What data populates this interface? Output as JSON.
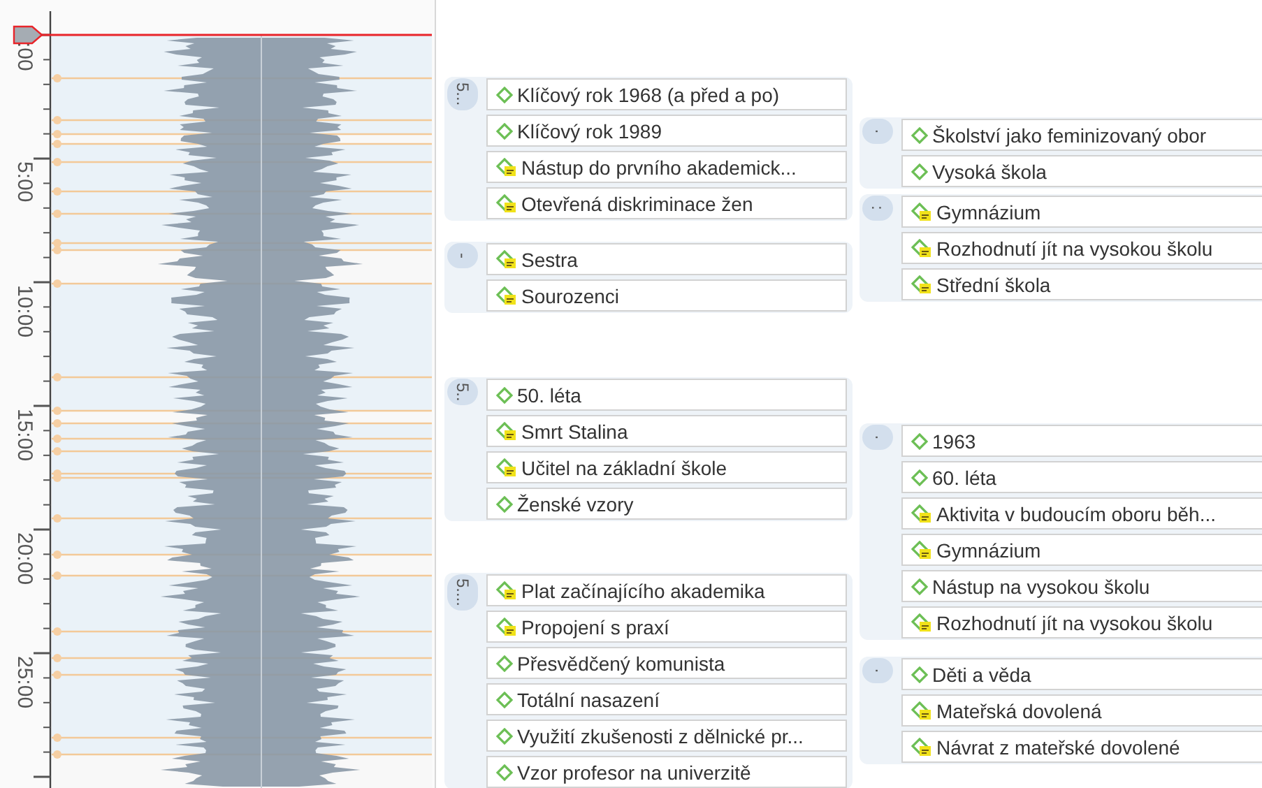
{
  "timeline": {
    "time_labels": [
      ":00",
      "5:00",
      "10:00",
      "15:00",
      "20:00",
      "25:00"
    ]
  },
  "columns": [
    {
      "groups": [
        {
          "badge": "5...",
          "items": [
            {
              "label": "Klíčový rok 1968 (a před a po)",
              "kind": "code"
            },
            {
              "label": "Klíčový rok 1989",
              "kind": "code"
            },
            {
              "label": "Nástup do prvního akademick...",
              "kind": "memo"
            },
            {
              "label": "Otevřená diskriminace žen",
              "kind": "memo"
            }
          ]
        },
        {
          "badge": "-",
          "items": [
            {
              "label": "Sestra",
              "kind": "memo"
            },
            {
              "label": "Sourozenci",
              "kind": "memo"
            }
          ]
        },
        {
          "badge": "5..",
          "items": [
            {
              "label": "50. léta",
              "kind": "code"
            },
            {
              "label": "Smrt Stalina",
              "kind": "memo"
            },
            {
              "label": "Učitel na základní škole",
              "kind": "memo"
            },
            {
              "label": "Ženské vzory",
              "kind": "code"
            }
          ]
        },
        {
          "badge": "5....",
          "items": [
            {
              "label": "Plat začínajícího akademika",
              "kind": "memo"
            },
            {
              "label": "Propojení s praxí",
              "kind": "memo"
            },
            {
              "label": "Přesvědčený komunista",
              "kind": "code"
            },
            {
              "label": "Totální nasazení",
              "kind": "code"
            },
            {
              "label": "Využití zkušenosti z dělnické pr...",
              "kind": "code"
            },
            {
              "label": "Vzor profesor na univerzitě",
              "kind": "code"
            }
          ]
        }
      ]
    },
    {
      "groups": [
        {
          "badge": "·",
          "items": [
            {
              "label": "Školství jako feminizovaný obor",
              "kind": "code"
            },
            {
              "label": "Vysoká škola",
              "kind": "code"
            }
          ]
        },
        {
          "badge": ":",
          "items": [
            {
              "label": "Gymnázium",
              "kind": "memo"
            },
            {
              "label": "Rozhodnutí jít na vysokou školu",
              "kind": "memo"
            },
            {
              "label": "Střední škola",
              "kind": "memo"
            }
          ]
        },
        {
          "badge": "·",
          "items": [
            {
              "label": "1963",
              "kind": "code"
            },
            {
              "label": "60. léta",
              "kind": "code"
            },
            {
              "label": "Aktivita v budoucím oboru běh...",
              "kind": "memo"
            },
            {
              "label": "Gymnázium",
              "kind": "memo"
            },
            {
              "label": "Nástup na vysokou školu",
              "kind": "code"
            },
            {
              "label": "Rozhodnutí jít na vysokou školu",
              "kind": "memo"
            }
          ]
        },
        {
          "badge": "·",
          "items": [
            {
              "label": "Děti a věda",
              "kind": "code"
            },
            {
              "label": "Mateřská dovolená",
              "kind": "memo"
            },
            {
              "label": "Návrat z mateřské dovolené",
              "kind": "memo"
            }
          ]
        }
      ]
    }
  ]
}
